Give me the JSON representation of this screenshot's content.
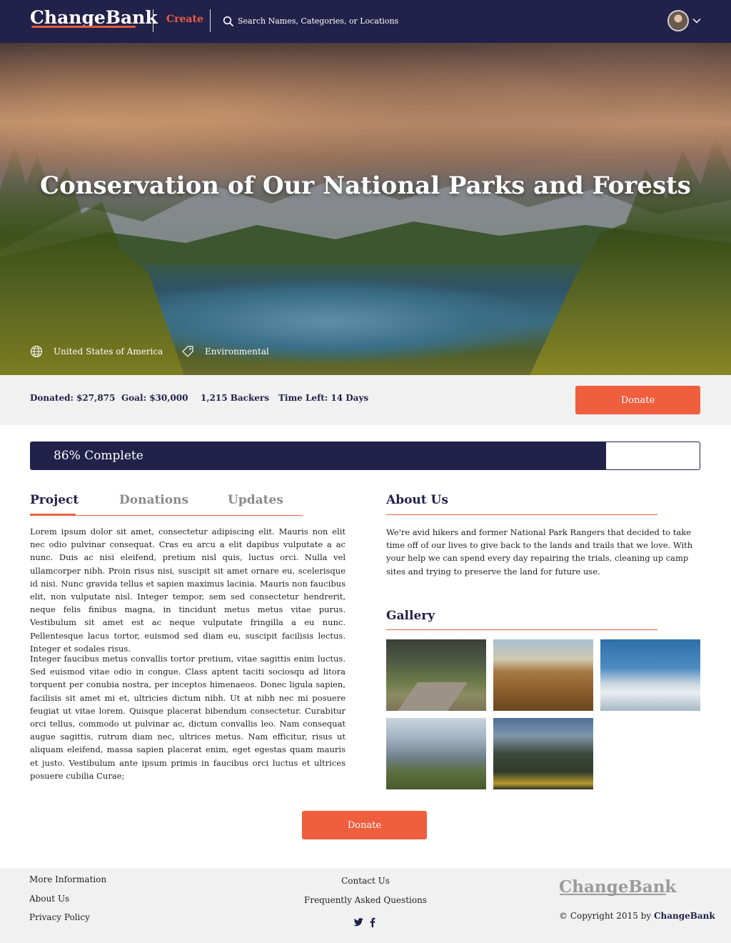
{
  "header": {
    "logo": "ChangeBank",
    "create_label": "Create",
    "search_placeholder": "Search Names, Categories, or Locations",
    "icons": [
      "search-icon",
      "avatar",
      "chevron-down-icon"
    ]
  },
  "hero": {
    "title": "Conservation of Our National Parks and Forests",
    "location": "United States of America",
    "category": "Environmental"
  },
  "stats": {
    "donated": "Donated: $27,875",
    "goal": "Goal: $30,000",
    "backers": "1,215 Backers",
    "time_left": "Time Left: 14 Days",
    "donate_label": "Donate"
  },
  "progress": {
    "label": "86% Complete",
    "value": 0.86
  },
  "tabs": [
    {
      "label": "Project",
      "active": true
    },
    {
      "label": "Donations",
      "active": false
    },
    {
      "label": "Updates",
      "active": false
    }
  ],
  "project": {
    "paragraph1": "Lorem ipsum dolor sit amet, consectetur adipiscing elit. Mauris non elit nec odio pulvinar consequat. Cras eu arcu a elit dapibus vulputate a ac nunc. Duis ac nisi eleifend, pretium nisl quis, luctus orci. Nulla vel ullamcorper nibh. Proin risus nisi, suscipit sit amet ornare eu, scelerisque id nisi. Nunc gravida tellus et sapien maximus lacinia. Mauris non faucibus elit, non vulputate nisl. Integer tempor, sem sed consectetur hendrerit, neque felis finibus magna, in tincidunt metus metus vitae purus. Vestibulum sit amet est ac neque vulputate fringilla a eu nunc. Pellentesque lacus tortor, euismod sed diam eu, suscipit facilisis lectus. Integer et sodales risus.",
    "paragraph2": "Integer faucibus metus convallis tortor pretium, vitae sagittis enim luctus. Sed euismod vitae odio in congue. Class aptent taciti sociosqu ad litora torquent per conubia nostra, per inceptos himenaeos. Donec ligula sapien, facilisis sit amet mi et, ultricies dictum nibh. Ut at nibh nec mi posuere feugiat ut vitae lorem. Quisque placerat bibendum consectetur. Curabitur orci tellus, commodo ut pulvinar ac, dictum convallis leo. Nam consequat augue sagittis, rutrum diam nec, ultrices metus. Nam efficitur, risus ut aliquam eleifend, massa sapien placerat enim, eget egestas quam mauris et justo. Vestibulum ante ipsum primis in faucibus orci luctus et ultrices posuere cubilia Curae;"
  },
  "about": {
    "title": "About Us",
    "text": "We're avid hikers and former National Park Rangers that decided to take time off of our lives to give back to the lands and trails that we love. With your help we can spend every day repairing the trials, cleaning up camp sites and trying to preserve the land for future use."
  },
  "gallery": {
    "title": "Gallery"
  },
  "bottom_donate_label": "Donate",
  "footer": {
    "more_info": "More Information",
    "about_us": "About Us",
    "privacy": "Privacy Policy",
    "contact": "Contact Us",
    "faq": "Frequently Asked Questions",
    "logo": "ChangeBank",
    "copyright_prefix": "© Copyright 2015 by ",
    "copyright_brand": "ChangeBank",
    "social": [
      "twitter-icon",
      "facebook-icon"
    ]
  },
  "colors": {
    "navy": "#21214a",
    "accent": "#ef5e3d",
    "light_bg": "#f1f1f1"
  }
}
